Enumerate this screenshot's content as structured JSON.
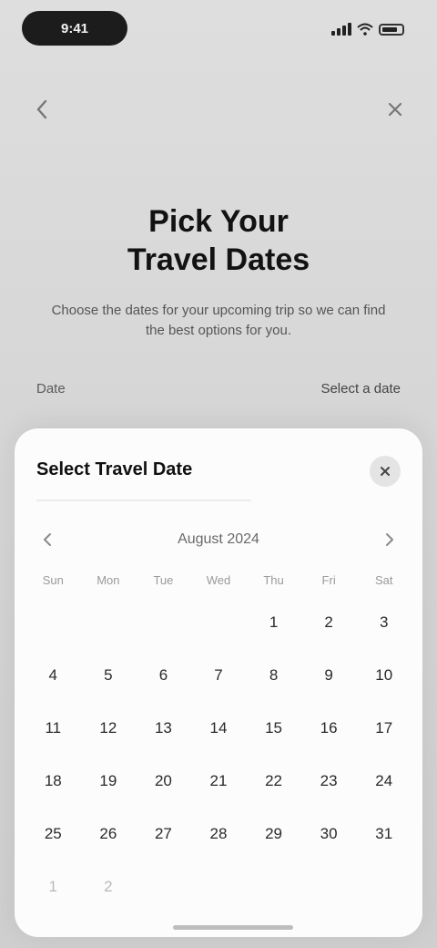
{
  "status_bar": {
    "time": "9:41"
  },
  "nav": {
    "back_icon": "chevron-left-icon",
    "close_icon": "close-icon"
  },
  "hero": {
    "title_line1": "Pick Your",
    "title_line2": "Travel Dates",
    "subtitle": "Choose the dates for your upcoming trip so we can find the best options for you."
  },
  "date_row": {
    "label": "Date",
    "value": "Select a date"
  },
  "sheet": {
    "title": "Select Travel Date",
    "close_icon": "close-icon",
    "month_label": "August 2024",
    "prev_icon": "chevron-left-icon",
    "next_icon": "chevron-right-icon",
    "weekdays": [
      "Sun",
      "Mon",
      "Tue",
      "Wed",
      "Thu",
      "Fri",
      "Sat"
    ],
    "days": [
      "",
      "",
      "",
      "",
      "1",
      "2",
      "3",
      "4",
      "5",
      "6",
      "7",
      "8",
      "9",
      "10",
      "11",
      "12",
      "13",
      "14",
      "15",
      "16",
      "17",
      "18",
      "19",
      "20",
      "21",
      "22",
      "23",
      "24",
      "25",
      "26",
      "27",
      "28",
      "29",
      "30",
      "31",
      "1",
      "2",
      "",
      "",
      "",
      "",
      ""
    ]
  }
}
